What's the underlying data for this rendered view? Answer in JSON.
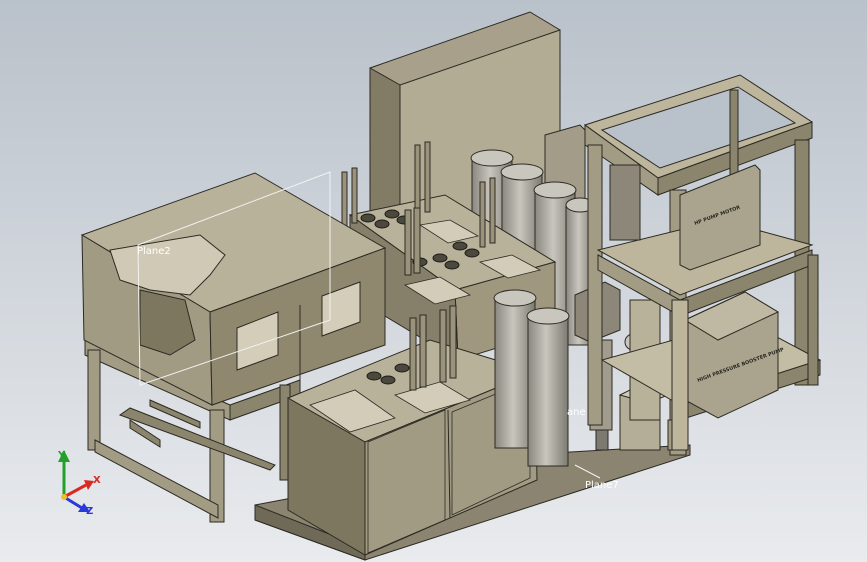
{
  "viewport": {
    "background_top": "#b9c1ca",
    "background_bottom": "#e9ebee"
  },
  "planes": {
    "plane_a": "Plane2",
    "plane_b": "ane",
    "plane_c": "Plane7"
  },
  "nameplates": {
    "upper_motor": "HP PUMP MOTOR",
    "lower_pump": "HIGH PRESSURE BOOSTER PUMP"
  },
  "triad": {
    "x_label": "X",
    "y_label": "Y",
    "z_label": "Z",
    "x_color": "#d82a20",
    "y_color": "#22a02a",
    "z_color": "#2a3ad8"
  },
  "colors": {
    "frame_light": "#bdb59c",
    "frame_dark": "#8c856d",
    "panel": "#a8a08b",
    "vessel": "#b4b0a8",
    "edge": "#2c2a22"
  }
}
